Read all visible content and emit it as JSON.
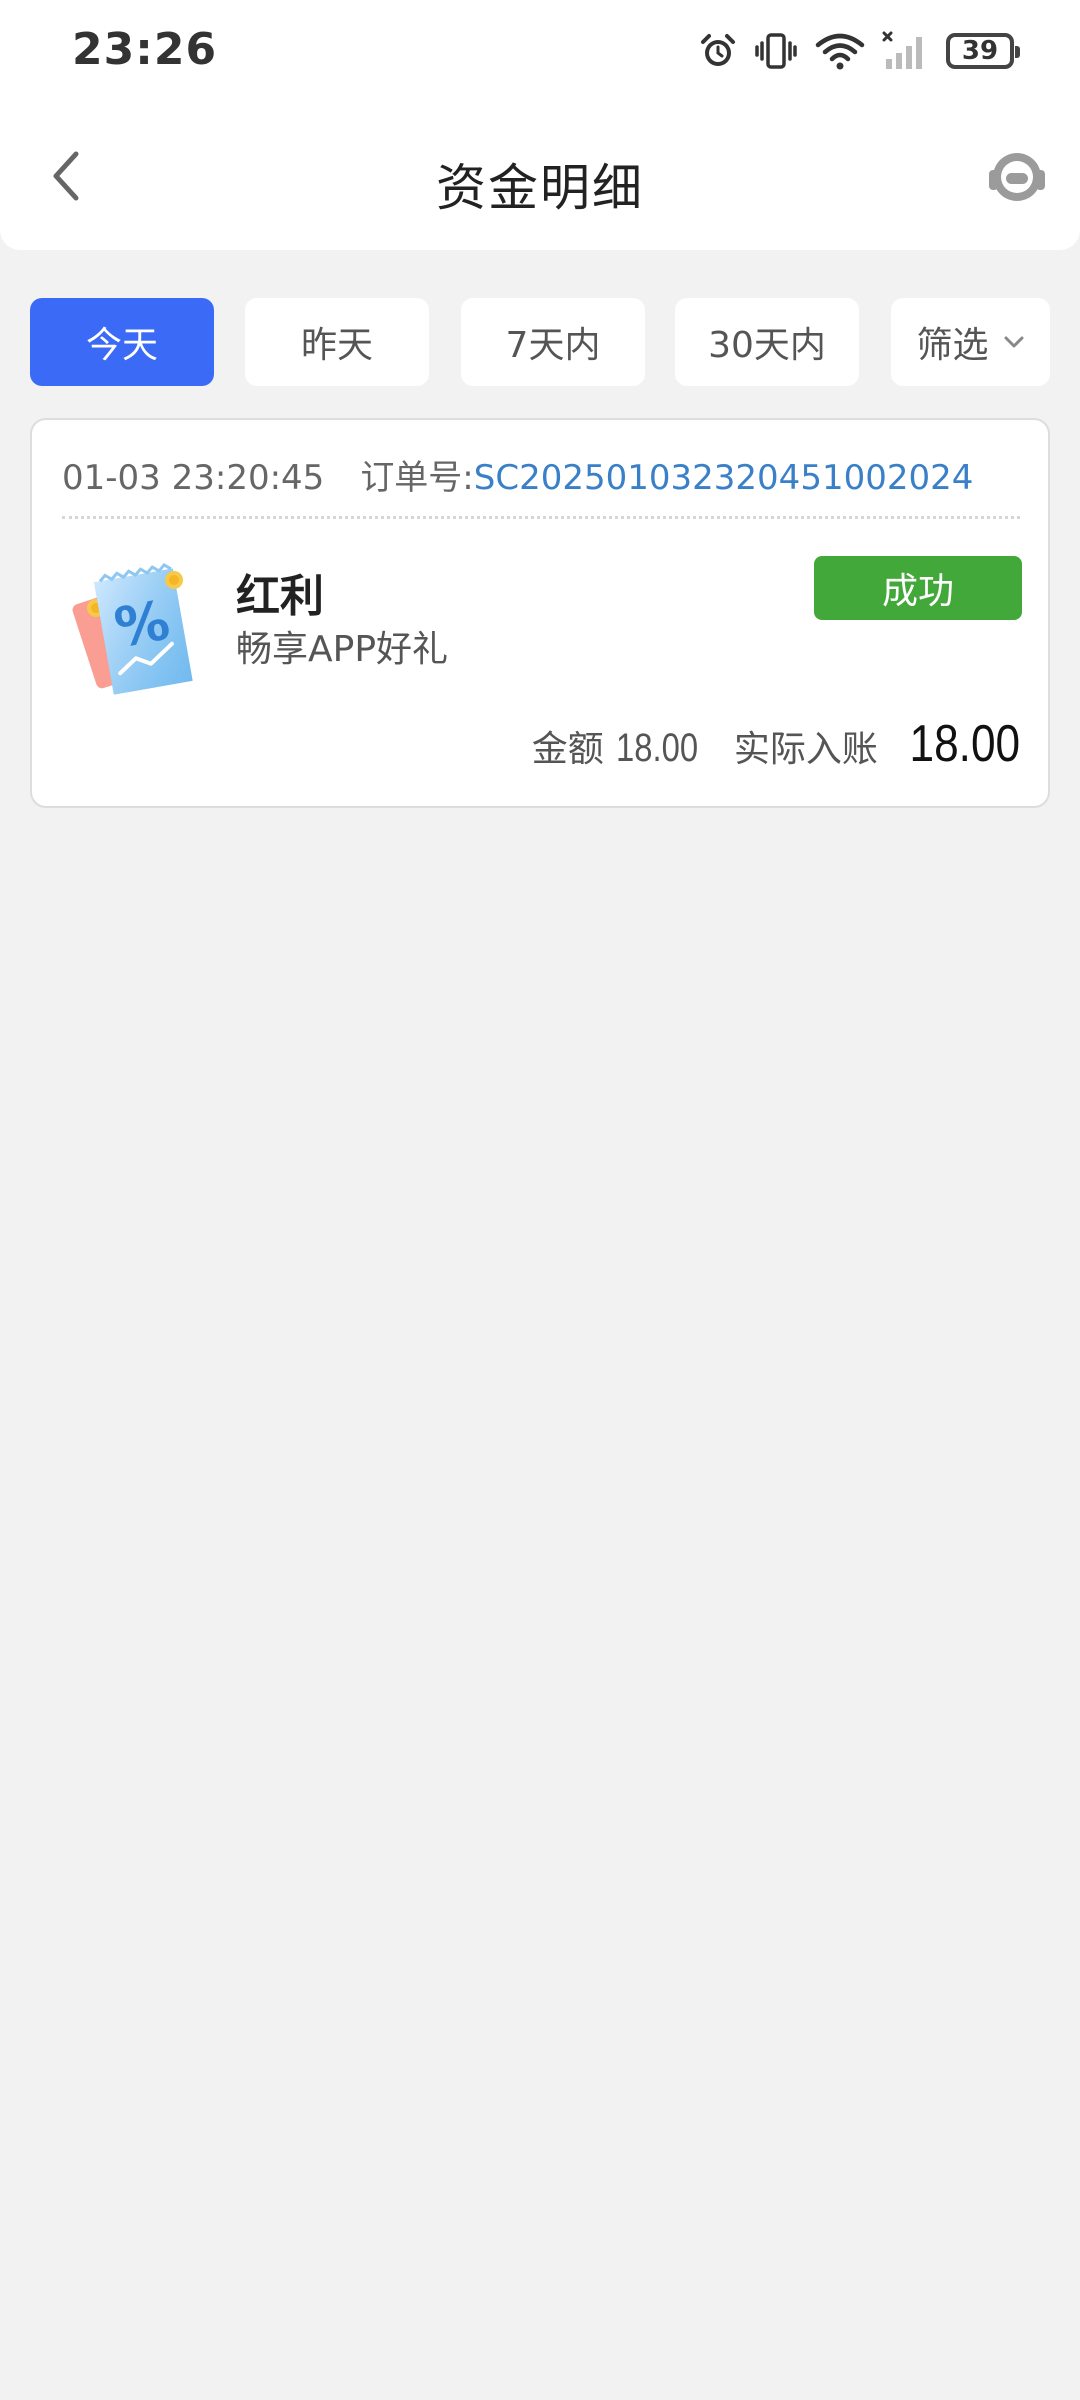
{
  "status_bar": {
    "time": "23:26",
    "icons": [
      "alarm-icon",
      "vibrate-icon",
      "wifi-icon",
      "signal-icon"
    ],
    "battery": "39"
  },
  "header": {
    "title": "资金明细",
    "back_icon": "back-arrow-icon",
    "service_icon": "customer-service-icon"
  },
  "tabs": [
    {
      "label": "今天",
      "active": true
    },
    {
      "label": "昨天",
      "active": false
    },
    {
      "label": "7天内",
      "active": false
    },
    {
      "label": "30天内",
      "active": false
    },
    {
      "label": "筛选",
      "active": false,
      "icon": "chevron-down-icon"
    }
  ],
  "records": [
    {
      "datetime": "01-03 23:20:45",
      "order_label": "订单号:",
      "order_no": "SC20250103232045100202​4",
      "title": "红利",
      "subtitle": "畅享APP好礼",
      "status": "成功",
      "amount_label": "金额",
      "amount": "18.00",
      "actual_label": "实际入账",
      "actual_amount": "18.00",
      "icon": "coupon-percent-icon"
    }
  ],
  "colors": {
    "accent": "#3b6af7",
    "success": "#43a83a",
    "order_link": "#3a80c8",
    "background": "#f2f2f2"
  }
}
